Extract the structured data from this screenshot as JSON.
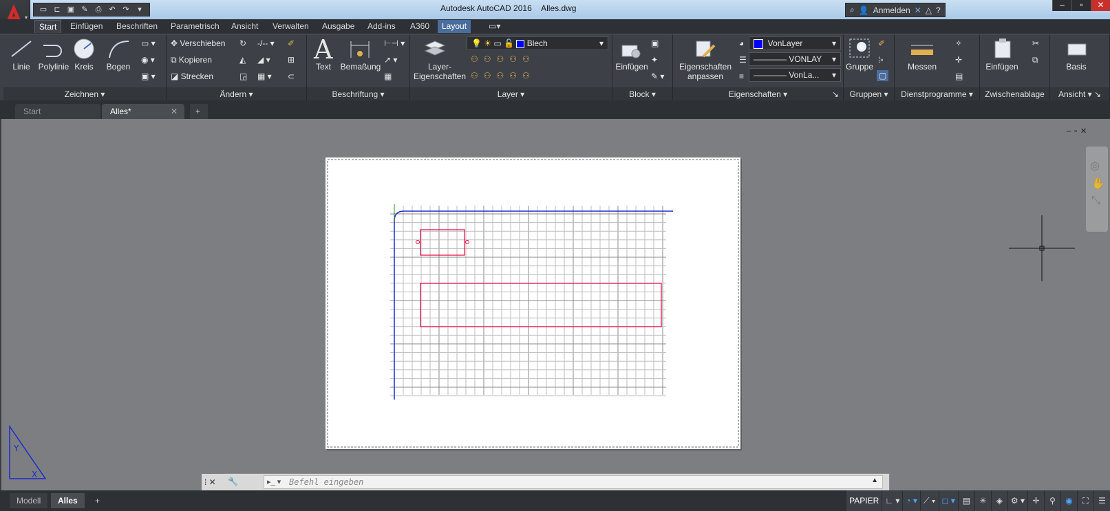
{
  "window": {
    "title": "Autodesk AutoCAD 2016",
    "filename": "Alles.dwg"
  },
  "quick_access": [
    "new-icon",
    "open-icon",
    "save-icon",
    "saveas-icon",
    "plot-icon",
    "undo-icon",
    "redo-icon",
    "customize-icon"
  ],
  "title_right": {
    "signin": "Anmelden"
  },
  "ribbon_tabs": [
    "Start",
    "Einfügen",
    "Beschriften",
    "Parametrisch",
    "Ansicht",
    "Verwalten",
    "Ausgabe",
    "Add-ins",
    "A360",
    "Layout"
  ],
  "panels": {
    "zeichnen": {
      "label": "Zeichnen",
      "tools": [
        "Linie",
        "Polylinie",
        "Kreis",
        "Bogen"
      ]
    },
    "aendern": {
      "label": "Ändern",
      "tools": [
        "Verschieben",
        "Kopieren",
        "Strecken"
      ]
    },
    "beschriftung": {
      "label": "Beschriftung",
      "tools": [
        "Text",
        "Bemaßung"
      ]
    },
    "layer": {
      "label": "Layer",
      "tool": "Layer-\nEigenschaften",
      "tool_l1": "Layer-",
      "tool_l2": "Eigenschaften",
      "current_layer": "Blech"
    },
    "block": {
      "label": "Block",
      "tool": "Einfügen"
    },
    "eigenschaften": {
      "label": "Eigenschaften",
      "tool_l1": "Eigenschaften",
      "tool_l2": "anpassen",
      "color": "VonLayer",
      "linetype": "VONLAY",
      "lineweight": "VonLa..."
    },
    "gruppen": {
      "label": "Gruppen",
      "tool": "Gruppe"
    },
    "dienstprogramme": {
      "label": "Dienstprogramme",
      "tool": "Messen"
    },
    "zwischenablage": {
      "label": "Zwischenablage",
      "tool": "Einfügen"
    },
    "ansicht": {
      "label": "Ansicht",
      "tool": "Basis"
    }
  },
  "doc_tabs": [
    "Start",
    "Alles*"
  ],
  "command": {
    "placeholder": "Befehl eingeben"
  },
  "layout_tabs": [
    "Modell",
    "Alles"
  ],
  "status": {
    "space": "PAPIER"
  },
  "colors": {
    "accent": "#4a6d9c",
    "cad_red": "#e8003c",
    "cad_blue": "#0000ff"
  }
}
